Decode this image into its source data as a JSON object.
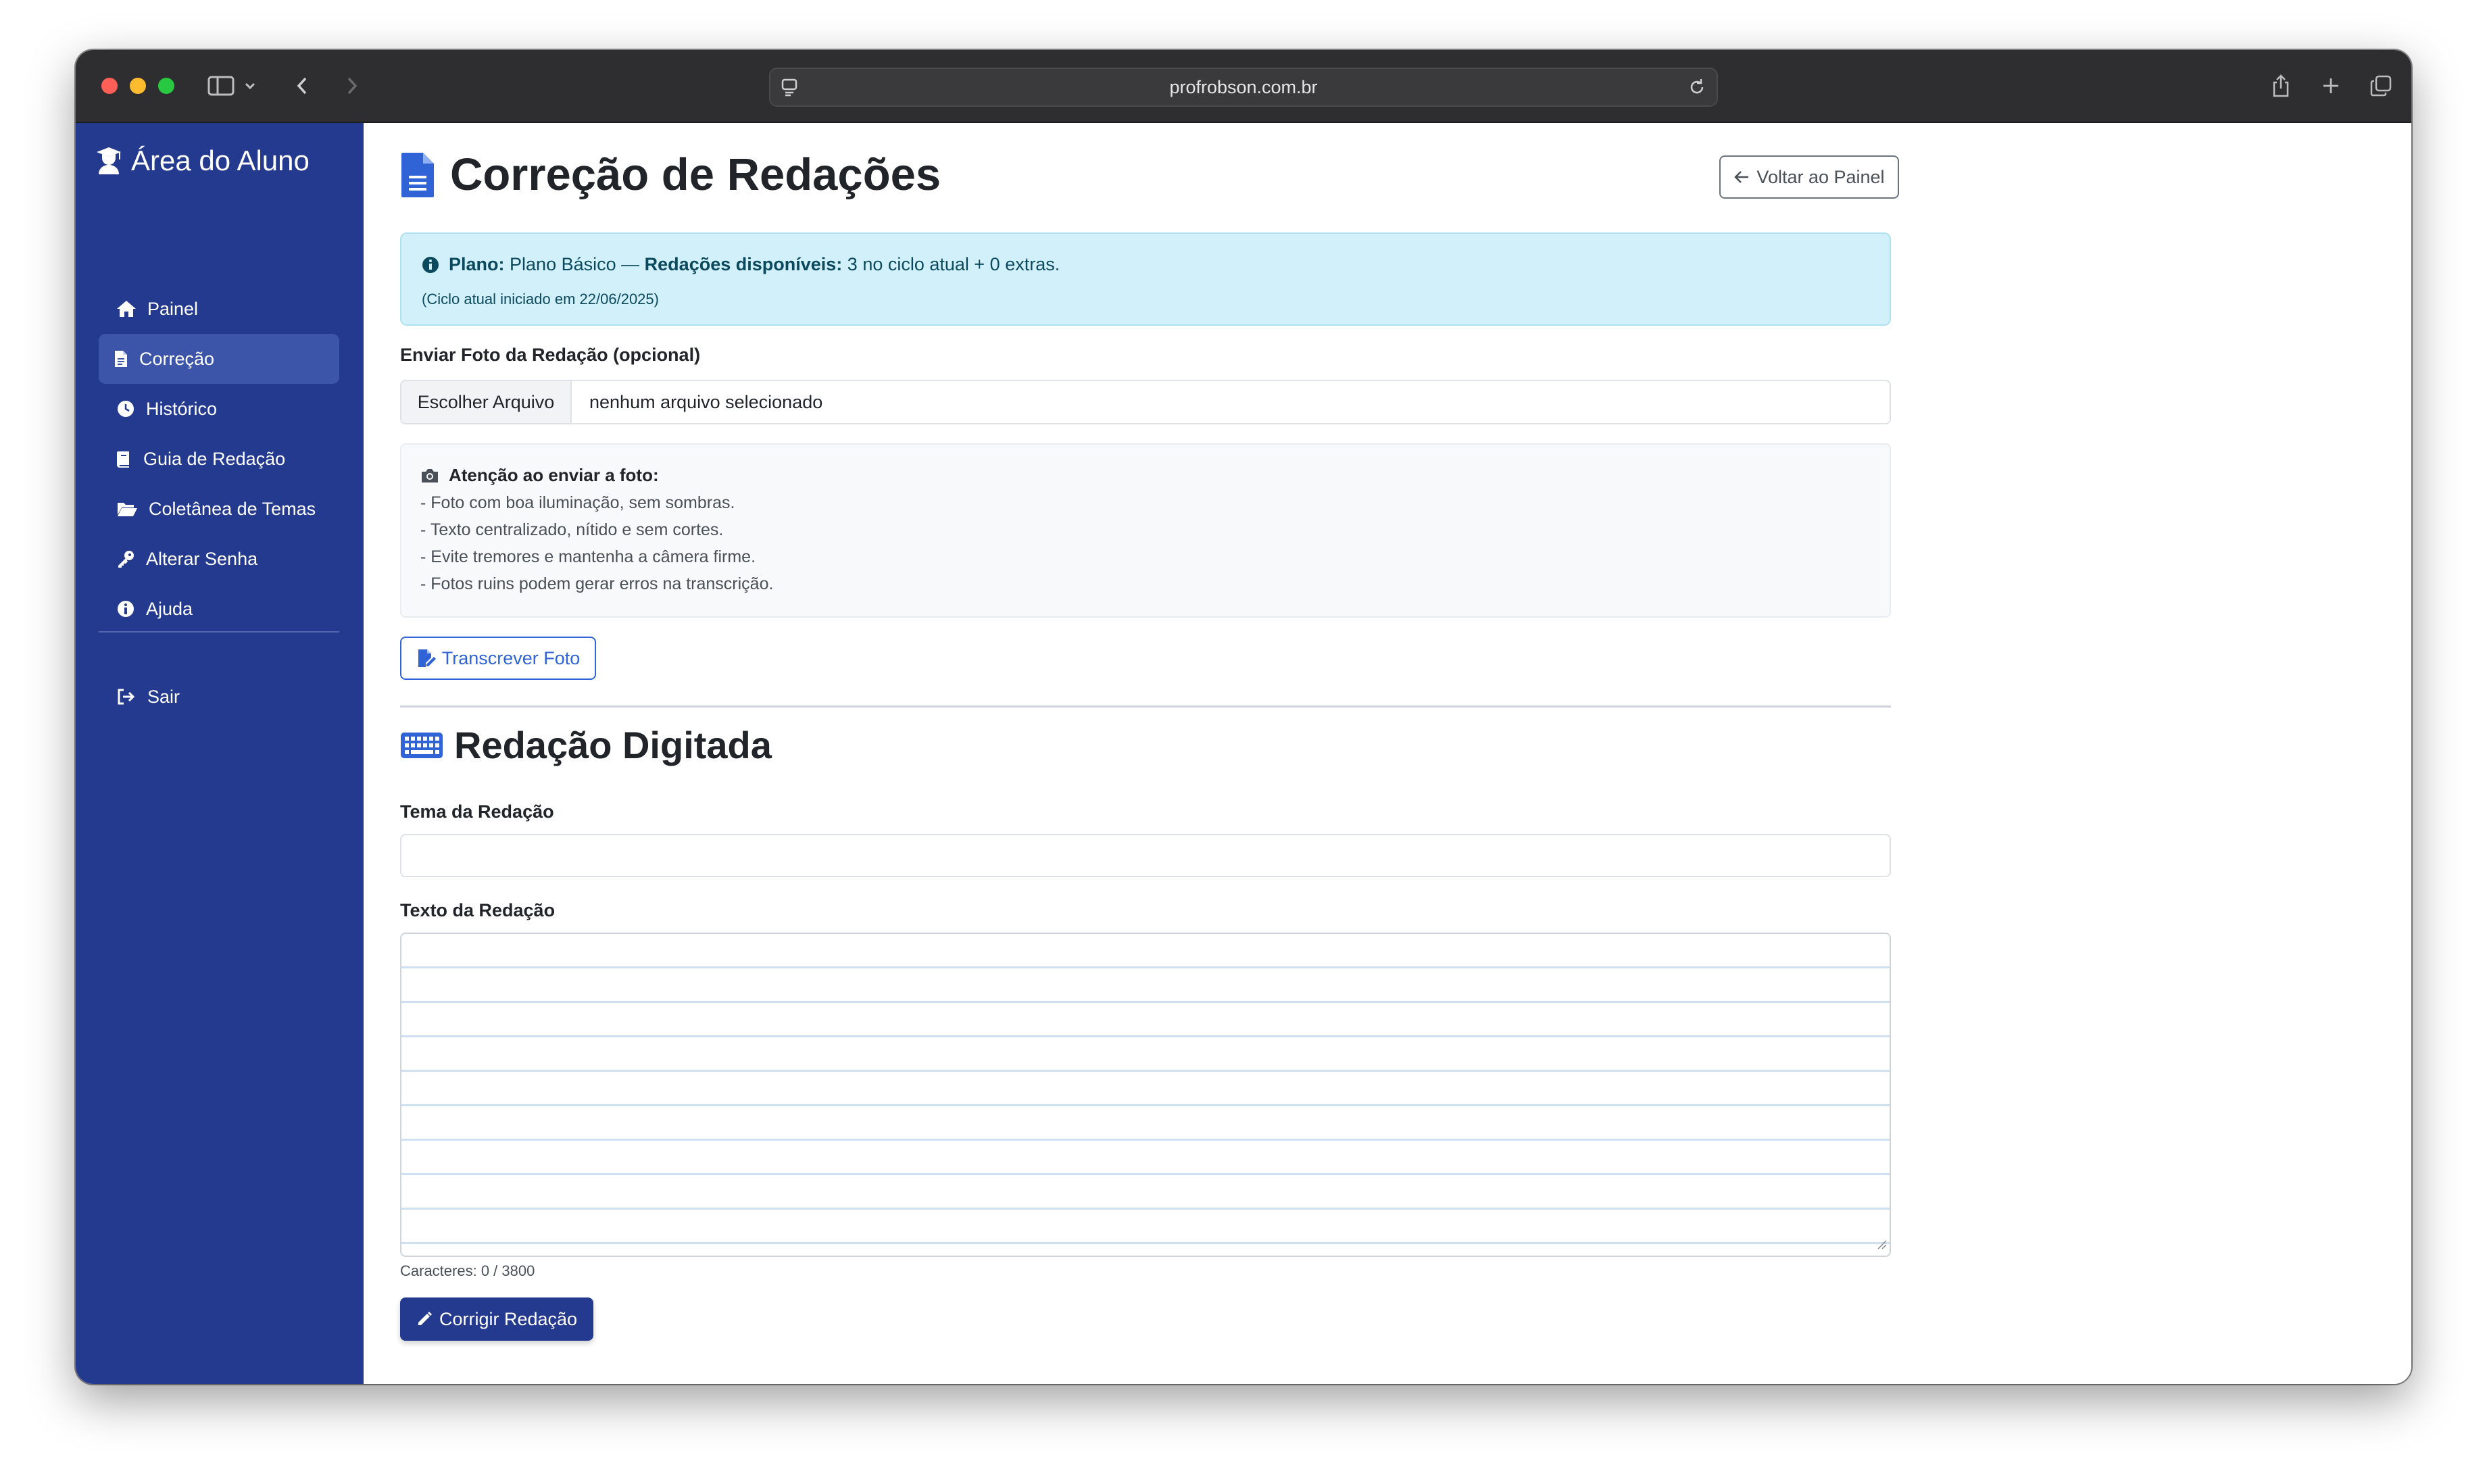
{
  "browser": {
    "url": "profrobson.com.br"
  },
  "sidebar": {
    "brand": "Área do Aluno",
    "items": [
      {
        "label": "Painel",
        "icon": "home-icon"
      },
      {
        "label": "Correção",
        "icon": "document-icon",
        "active": true
      },
      {
        "label": "Histórico",
        "icon": "clock-icon"
      },
      {
        "label": "Guia de Redação",
        "icon": "book-icon"
      },
      {
        "label": "Coletânea de Temas",
        "icon": "folder-open-icon"
      },
      {
        "label": "Alterar Senha",
        "icon": "key-icon"
      },
      {
        "label": "Ajuda",
        "icon": "info-icon"
      }
    ],
    "logout": {
      "label": "Sair",
      "icon": "sign-out-icon"
    }
  },
  "page": {
    "title": "Correção de Redações",
    "back_button": "Voltar ao Painel"
  },
  "plan_alert": {
    "plan_label": "Plano:",
    "plan_value": "Plano Básico",
    "separator": "—",
    "available_label": "Redações disponíveis:",
    "available_value": "3 no ciclo atual + 0 extras.",
    "cycle_text": "(Ciclo atual iniciado em 22/06/2025)"
  },
  "photo_upload": {
    "label": "Enviar Foto da Redação (opcional)",
    "choose_button": "Escolher Arquivo",
    "file_status": "nenhum arquivo selecionado",
    "tips_title": "Atenção ao enviar a foto:",
    "tips": [
      "- Foto com boa iluminação, sem sombras.",
      "- Texto centralizado, nítido e sem cortes.",
      "- Evite tremores e mantenha a câmera firme.",
      "- Fotos ruins podem gerar erros na transcrição."
    ],
    "transcribe_button": "Transcrever Foto"
  },
  "typed_essay": {
    "section_title": "Redação Digitada",
    "theme_label": "Tema da Redação",
    "theme_value": "",
    "text_label": "Texto da Redação",
    "text_value": "",
    "char_count": "Caracteres: 0 / 3800",
    "submit_button": "Corrigir Redação"
  },
  "colors": {
    "sidebar": "#243a8f",
    "sidebar_active": "#3d55a8",
    "primary": "#2f63d6",
    "alert_bg": "#d1f0fa",
    "text": "#212529"
  }
}
